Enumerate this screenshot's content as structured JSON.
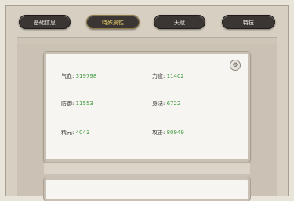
{
  "tabs": [
    {
      "label": "基础信息",
      "active": false
    },
    {
      "label": "特殊属性",
      "active": true
    },
    {
      "label": "天赋",
      "active": false
    },
    {
      "label": "特技",
      "active": false
    }
  ],
  "stats": [
    {
      "label": "气血:",
      "value": "319798"
    },
    {
      "label": "力道:",
      "value": "11402"
    },
    {
      "label": "防御:",
      "value": "11553"
    },
    {
      "label": "身法:",
      "value": "6722"
    },
    {
      "label": "精元:",
      "value": "4043"
    },
    {
      "label": "攻击:",
      "value": "80949"
    }
  ],
  "corner_icon": "settings-icon",
  "colors": {
    "value_green": "#3c9a3c",
    "tab_active_text": "#f0d66b"
  }
}
